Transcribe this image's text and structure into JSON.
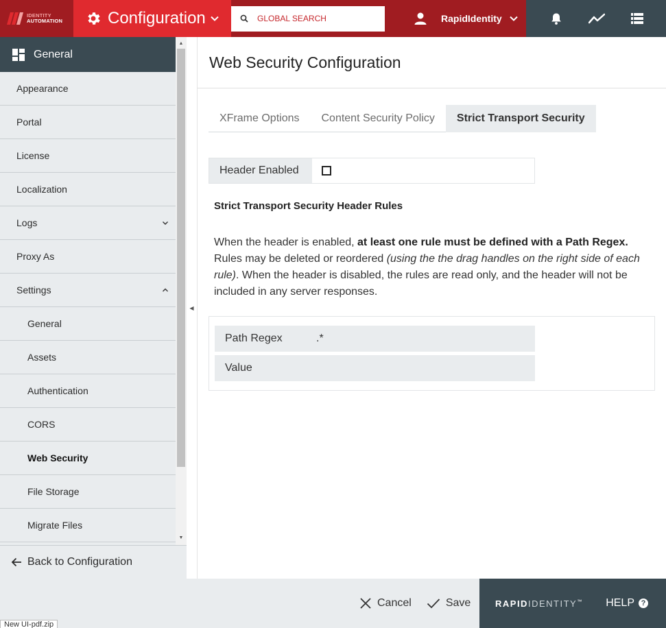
{
  "brand": {
    "line1": "IDENTITY",
    "line2": "AUTOMATION",
    "color": "#a01c21"
  },
  "module": {
    "title": "Configuration",
    "icon": "gear-icon",
    "color": "#e02a2f"
  },
  "search": {
    "placeholder": "GLOBAL SEARCH",
    "value": ""
  },
  "user": {
    "name": "RapidIdentity"
  },
  "top_icons": [
    "bell-icon",
    "activity-icon",
    "list-icon"
  ],
  "sidebar": {
    "header": "General",
    "items": [
      {
        "label": "Appearance",
        "sub": false,
        "active": false,
        "chevron": ""
      },
      {
        "label": "Portal",
        "sub": false,
        "active": false,
        "chevron": ""
      },
      {
        "label": "License",
        "sub": false,
        "active": false,
        "chevron": ""
      },
      {
        "label": "Localization",
        "sub": false,
        "active": false,
        "chevron": ""
      },
      {
        "label": "Logs",
        "sub": false,
        "active": false,
        "chevron": "down"
      },
      {
        "label": "Proxy As",
        "sub": false,
        "active": false,
        "chevron": ""
      },
      {
        "label": "Settings",
        "sub": false,
        "active": false,
        "chevron": "up"
      },
      {
        "label": "General",
        "sub": true,
        "active": false,
        "chevron": ""
      },
      {
        "label": "Assets",
        "sub": true,
        "active": false,
        "chevron": ""
      },
      {
        "label": "Authentication",
        "sub": true,
        "active": false,
        "chevron": ""
      },
      {
        "label": "CORS",
        "sub": true,
        "active": false,
        "chevron": ""
      },
      {
        "label": "Web Security",
        "sub": true,
        "active": true,
        "chevron": ""
      },
      {
        "label": "File Storage",
        "sub": true,
        "active": false,
        "chevron": ""
      },
      {
        "label": "Migrate Files",
        "sub": true,
        "active": false,
        "chevron": ""
      },
      {
        "label": "",
        "sub": true,
        "active": false,
        "chevron": ""
      }
    ],
    "back_label": "Back to Configuration"
  },
  "page": {
    "title": "Web Security Configuration",
    "tabs": [
      {
        "label": "XFrame Options",
        "active": false
      },
      {
        "label": "Content Security Policy",
        "active": false
      },
      {
        "label": "Strict Transport Security",
        "active": true
      }
    ],
    "header_enabled_label": "Header Enabled",
    "header_enabled": false,
    "rules_title": "Strict Transport Security Header Rules",
    "desc": {
      "p1": "When the header is enabled, ",
      "b1": "at least one rule must be defined with a Path Regex.",
      "p2": " Rules may be deleted or reordered ",
      "i1": "(using the the drag handles on the right side of each rule)",
      "p3": ". When the header is disabled, the rules are read only, and the header will not be included in any server responses."
    },
    "rules": [
      {
        "key": "Path Regex",
        "value": ".*"
      },
      {
        "key": "Value",
        "value": ""
      }
    ]
  },
  "footer": {
    "cancel": "Cancel",
    "save": "Save",
    "rid_bold": "RAPID",
    "rid_light": "IDENTITY",
    "rid_tm": "™",
    "help": "HELP"
  },
  "status_text": "New UI-pdf.zip"
}
